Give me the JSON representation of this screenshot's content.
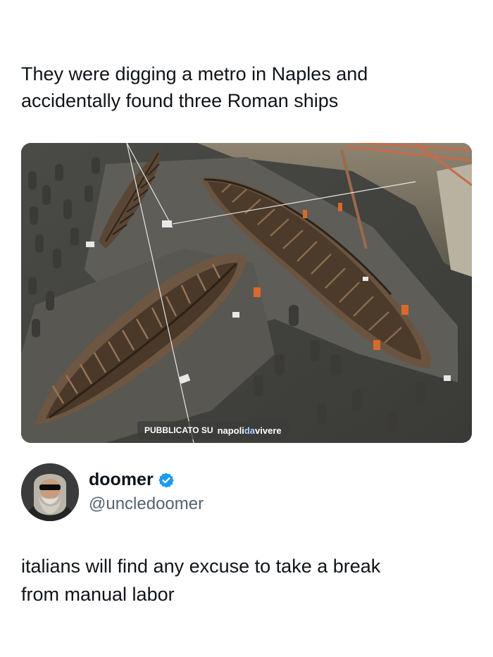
{
  "post": {
    "caption": "They were digging a metro in Naples and\naccidentally found three Roman ships",
    "media": {
      "watermark_prefix": "PUBBLICATO SU",
      "watermark_brand_1": "napoli",
      "watermark_brand_2": "da",
      "watermark_brand_3": "vivere"
    }
  },
  "tweet": {
    "display_name": "doomer",
    "handle": "@uncledoomer",
    "verified_icon": "verified-badge-icon",
    "text": "italians will find any excuse to take a break\nfrom manual labor"
  },
  "colors": {
    "verified": "#1d9bf0",
    "handle": "#536471",
    "text": "#0f1419"
  }
}
